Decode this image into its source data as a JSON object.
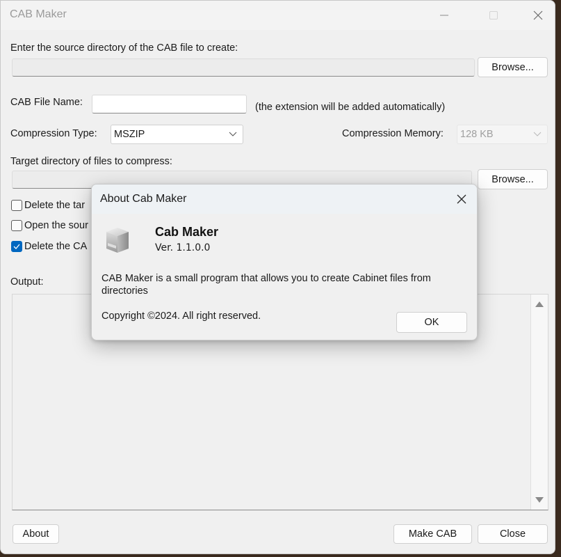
{
  "window": {
    "title": "CAB Maker",
    "controls": {
      "minimize": "minimize-icon",
      "maximize": "maximize-icon",
      "close": "close-icon"
    }
  },
  "source": {
    "label": "Enter the source directory of the CAB file to create:",
    "value": "",
    "browse_label": "Browse..."
  },
  "cab_file": {
    "label": "CAB File Name:",
    "value": "",
    "hint": "(the extension will be added automatically)"
  },
  "compression": {
    "type_label": "Compression Type:",
    "type_value": "MSZIP",
    "memory_label": "Compression Memory:",
    "memory_value": "128 KB"
  },
  "target": {
    "label": "Target directory of files to compress:",
    "value": "",
    "browse_label": "Browse..."
  },
  "options": [
    {
      "label": "Delete the tar",
      "checked": false
    },
    {
      "label": "Open the sour",
      "checked": false
    },
    {
      "label": "Delete the CA",
      "checked": true
    }
  ],
  "output": {
    "label": "Output:",
    "content": ""
  },
  "footer": {
    "about_label": "About",
    "make_cab_label": "Make CAB",
    "close_label": "Close"
  },
  "about_dialog": {
    "title": "About Cab Maker",
    "app_name": "Cab Maker",
    "version": "Ver. 1.1.0.0",
    "description": "CAB Maker is a small program that allows you to create Cabinet files from directories",
    "copyright": "Copyright ©2024. All right reserved.",
    "ok_label": "OK",
    "icon": "cabinet-box-icon"
  },
  "colors": {
    "accent": "#0067c0",
    "window_bg": "#f0f0f0",
    "title_text": "#9a9a9a"
  }
}
